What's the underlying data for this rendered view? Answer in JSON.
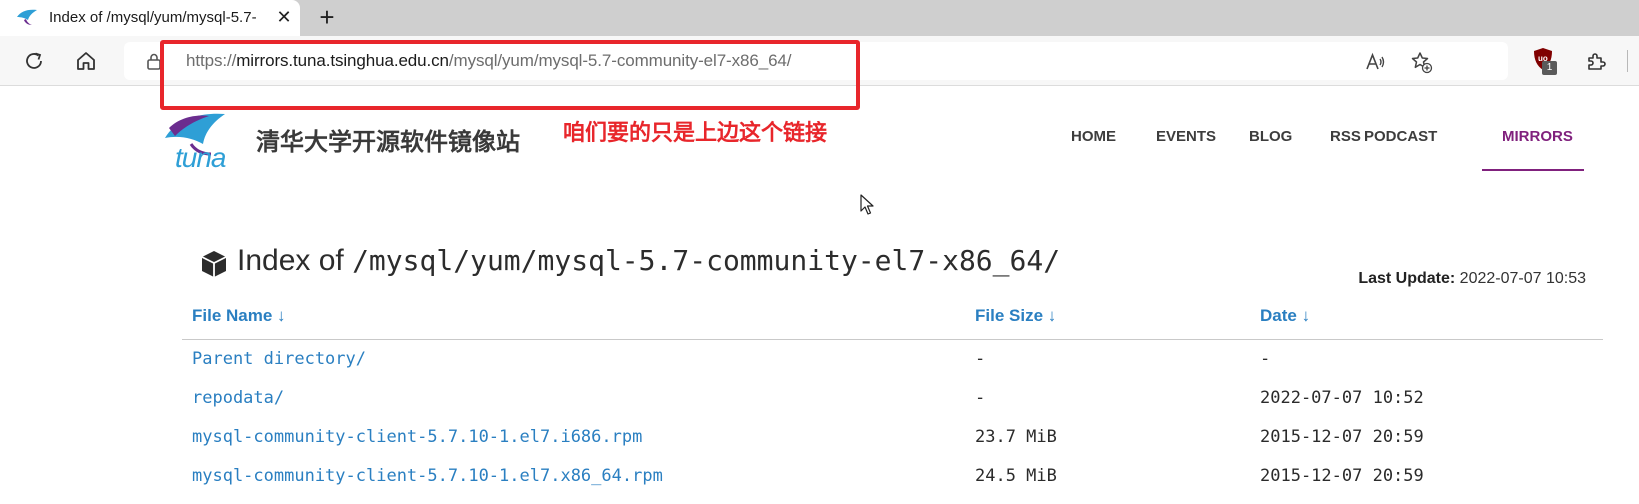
{
  "browser": {
    "tab_title": "Index of /mysql/yum/mysql-5.7-",
    "address": {
      "scheme": "https://",
      "host": "mirrors.tuna.tsinghua.edu.cn",
      "path": "/mysql/yum/mysql-5.7-community-el7-x86_64/"
    },
    "extension_badge_count": "1",
    "accent": "#e8262b"
  },
  "annotation": {
    "text": "咱们要的只是上边这个链接"
  },
  "site": {
    "logo_text": "tuna",
    "name": "清华大学开源软件镜像站",
    "nav": [
      {
        "label": "HOME"
      },
      {
        "label": "EVENTS"
      },
      {
        "label": "BLOG"
      },
      {
        "label": "RSS"
      },
      {
        "label": "PODCAST"
      },
      {
        "label": "MIRRORS",
        "active": true
      }
    ],
    "accent": "#80217d"
  },
  "index": {
    "title_prefix": "Index of ",
    "path": "/mysql/yum/mysql-5.7-community-el7-x86_64/",
    "last_update_label": "Last Update:",
    "last_update_value": "2022-07-07 10:53",
    "columns": {
      "name": "File Name ↓",
      "size": "File Size ↓",
      "date": "Date ↓"
    },
    "rows": [
      {
        "name": "Parent directory/",
        "size": "-",
        "date": "-"
      },
      {
        "name": "repodata/",
        "size": "-",
        "date": "2022-07-07 10:52"
      },
      {
        "name": "mysql-community-client-5.7.10-1.el7.i686.rpm",
        "size": "23.7 MiB",
        "date": "2015-12-07 20:59"
      },
      {
        "name": "mysql-community-client-5.7.10-1.el7.x86_64.rpm",
        "size": "24.5 MiB",
        "date": "2015-12-07 20:59"
      }
    ],
    "link_color": "#2a7fc1"
  }
}
